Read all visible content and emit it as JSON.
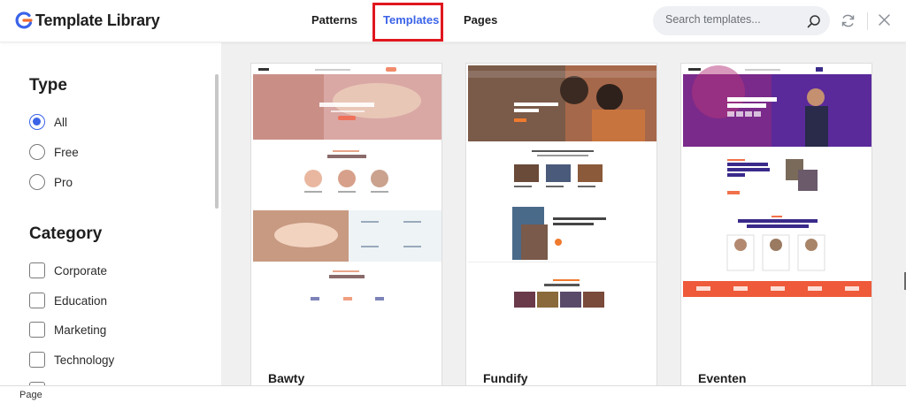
{
  "header": {
    "title": "Template Library",
    "tabs": [
      {
        "label": "Patterns",
        "active": false
      },
      {
        "label": "Templates",
        "active": true
      },
      {
        "label": "Pages",
        "active": false
      }
    ],
    "search_placeholder": "Search templates...",
    "icons": {
      "search": "search-icon",
      "refresh": "refresh-icon",
      "close": "close-icon"
    },
    "accent_color": "#3b63e8",
    "highlight_color": "#e0161e"
  },
  "sidebar": {
    "type_heading": "Type",
    "type_options": [
      {
        "label": "All",
        "selected": true
      },
      {
        "label": "Free",
        "selected": false
      },
      {
        "label": "Pro",
        "selected": false
      }
    ],
    "category_heading": "Category",
    "category_options": [
      {
        "label": "Corporate",
        "checked": false
      },
      {
        "label": "Education",
        "checked": false
      },
      {
        "label": "Marketing",
        "checked": false
      },
      {
        "label": "Technology",
        "checked": false
      }
    ]
  },
  "templates": [
    {
      "name": "Bawty"
    },
    {
      "name": "Fundify"
    },
    {
      "name": "Eventen"
    }
  ],
  "statusbar": {
    "text": "Page"
  }
}
